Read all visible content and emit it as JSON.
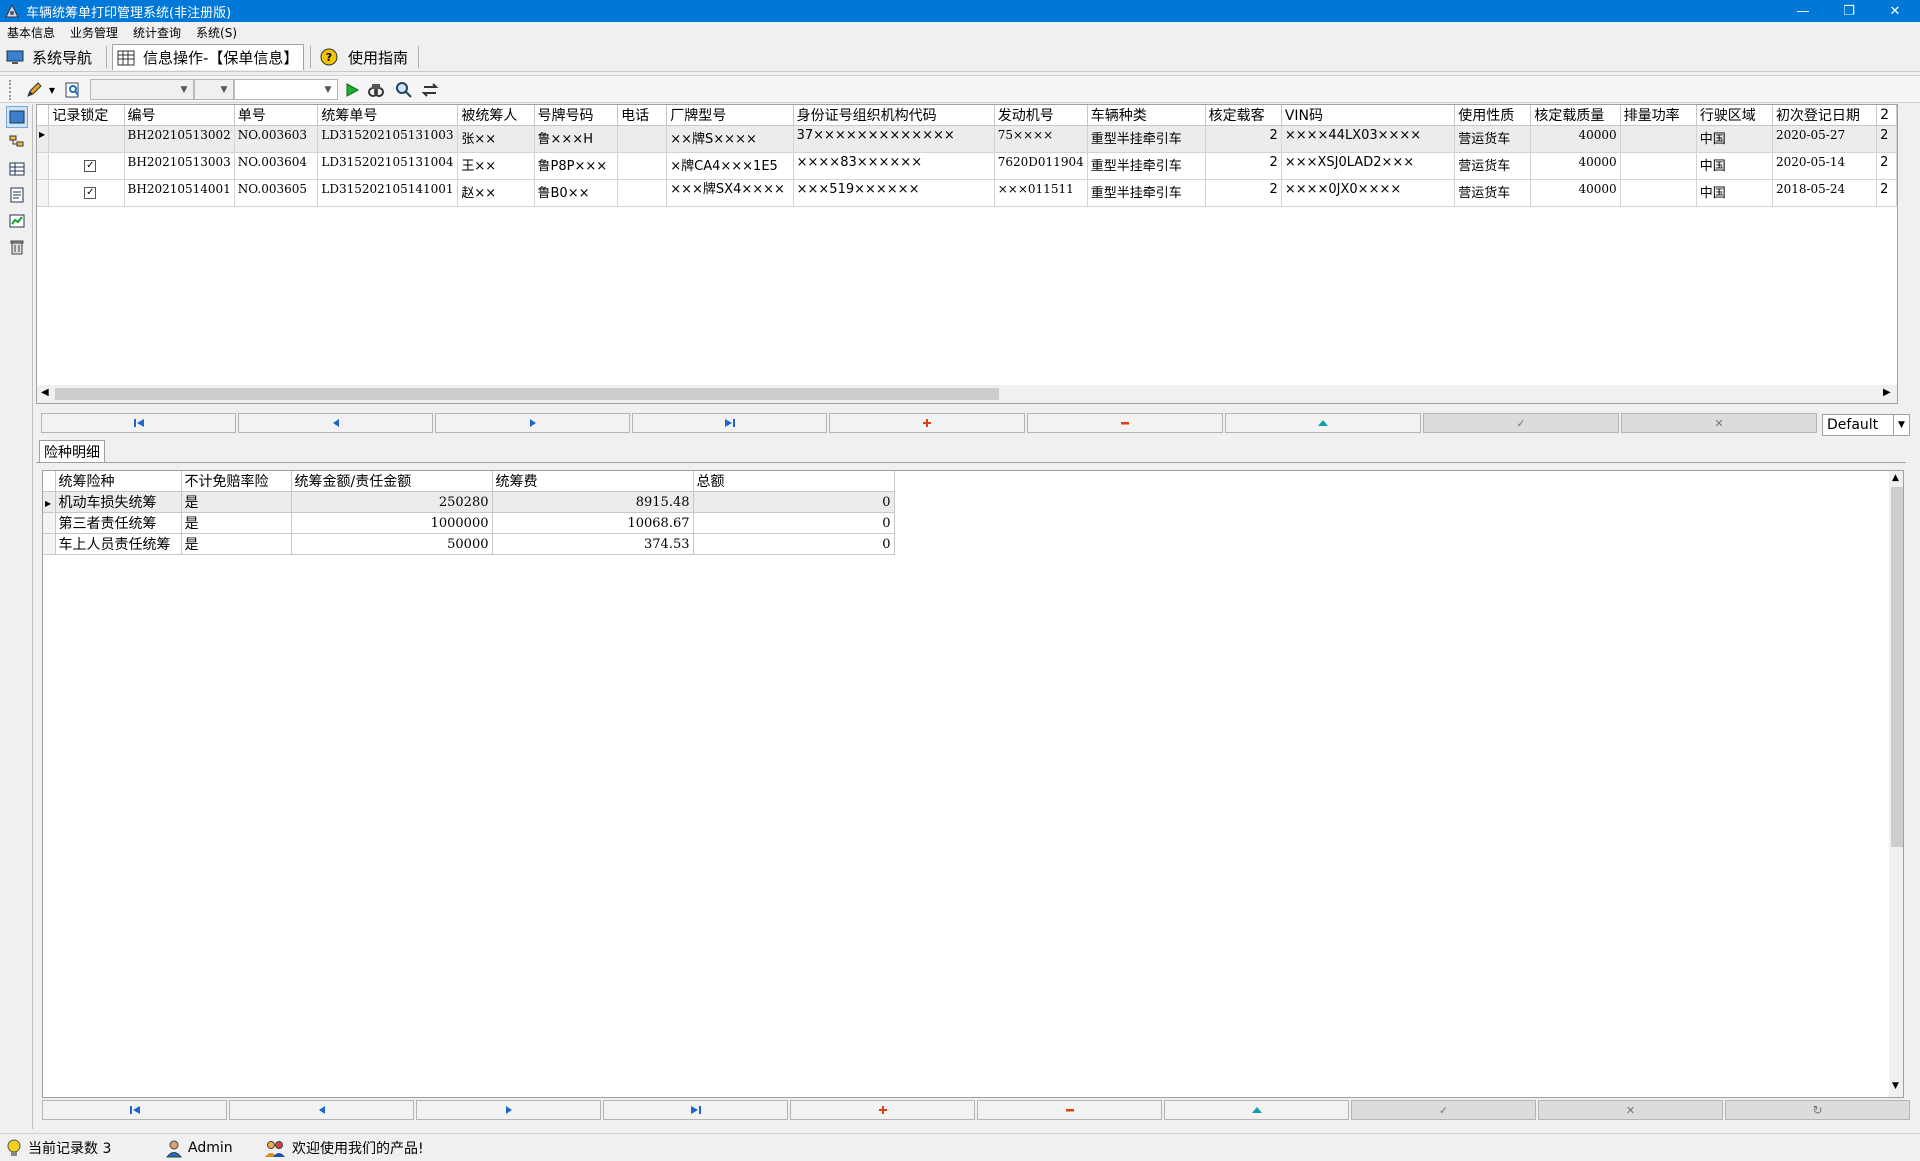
{
  "window": {
    "title": "车辆统筹单打印管理系统(非注册版)",
    "minimize": "—",
    "restore": "❐",
    "close": "✕"
  },
  "menu": [
    "基本信息",
    "业务管理",
    "统计查询",
    "系统(S)"
  ],
  "tabs": [
    {
      "label": "系统导航",
      "active": false
    },
    {
      "label": "信息操作-【保单信息】",
      "active": true
    },
    {
      "label": "使用指南",
      "active": false
    }
  ],
  "toolbar": {
    "combo1_value": "",
    "combo2_value": "",
    "search_value": ""
  },
  "main_grid": {
    "columns": [
      "记录锁定",
      "编号",
      "单号",
      "统筹单号",
      "被统筹人",
      "号牌号码",
      "电话",
      "厂牌型号",
      "身份证号组织机构代码",
      "发动机号",
      "车辆种类",
      "核定载客",
      "VIN码",
      "使用性质",
      "核定载质量",
      "排量功率",
      "行驶区域",
      "初次登记日期"
    ],
    "rows": [
      {
        "locked": false,
        "id": "BH20210513002",
        "no": "NO.003603",
        "policy": "LD315202105131003",
        "insured": "张××",
        "plate": "鲁×××H",
        "phone": "",
        "model": "××牌S××××",
        "idcode": "37×××××××××××××",
        "engine": "75××××",
        "vtype": "重型半挂牵引车",
        "seats": "2",
        "vin": "××××44LX03××××",
        "usage": "营运货车",
        "load": "40000",
        "power": "",
        "region": "中国",
        "regdate": "2020-05-27"
      },
      {
        "locked": true,
        "id": "BH20210513003",
        "no": "NO.003604",
        "policy": "LD315202105131004",
        "insured": "王××",
        "plate": "鲁P8P×××",
        "phone": "",
        "model": "×牌CA4×××1E5",
        "idcode": "××××83××××××",
        "engine": "7620D011904",
        "vtype": "重型半挂牵引车",
        "seats": "2",
        "vin": "×××XSJ0LAD2×××",
        "usage": "营运货车",
        "load": "40000",
        "power": "",
        "region": "中国",
        "regdate": "2020-05-14"
      },
      {
        "locked": true,
        "id": "BH20210514001",
        "no": "NO.003605",
        "policy": "LD315202105141001",
        "insured": "赵××",
        "plate": "鲁B0××",
        "phone": "",
        "model": "×××牌SX4××××",
        "idcode": "×××519××××××",
        "engine": "×××011511",
        "vtype": "重型半挂牵引车",
        "seats": "2",
        "vin": "××××0JX0××××",
        "usage": "营运货车",
        "load": "40000",
        "power": "",
        "region": "中国",
        "regdate": "2018-05-24"
      }
    ]
  },
  "layout_select": {
    "value": "Default"
  },
  "detail_tab": {
    "label": "险种明细"
  },
  "detail_grid": {
    "columns": [
      "统筹险种",
      "不计免赔率险",
      "统筹金额/责任金额",
      "统筹费",
      "总额"
    ],
    "rows": [
      {
        "type": "机动车损失统筹",
        "nodeduct": "是",
        "amount": "250280",
        "fee": "8915.48",
        "total": "0"
      },
      {
        "type": "第三者责任统筹",
        "nodeduct": "是",
        "amount": "1000000",
        "fee": "10068.67",
        "total": "0"
      },
      {
        "type": "车上人员责任统筹",
        "nodeduct": "是",
        "amount": "50000",
        "fee": "374.53",
        "total": "0"
      }
    ]
  },
  "status": {
    "record_count": "当前记录数 3",
    "user": "Admin",
    "welcome": "欢迎使用我们的产品!"
  },
  "colors": {
    "titlebar": "#0078d7",
    "nav_arrow": "#1e64d2",
    "add": "#e04010",
    "delete": "#e04010",
    "up": "#10a0b0"
  }
}
